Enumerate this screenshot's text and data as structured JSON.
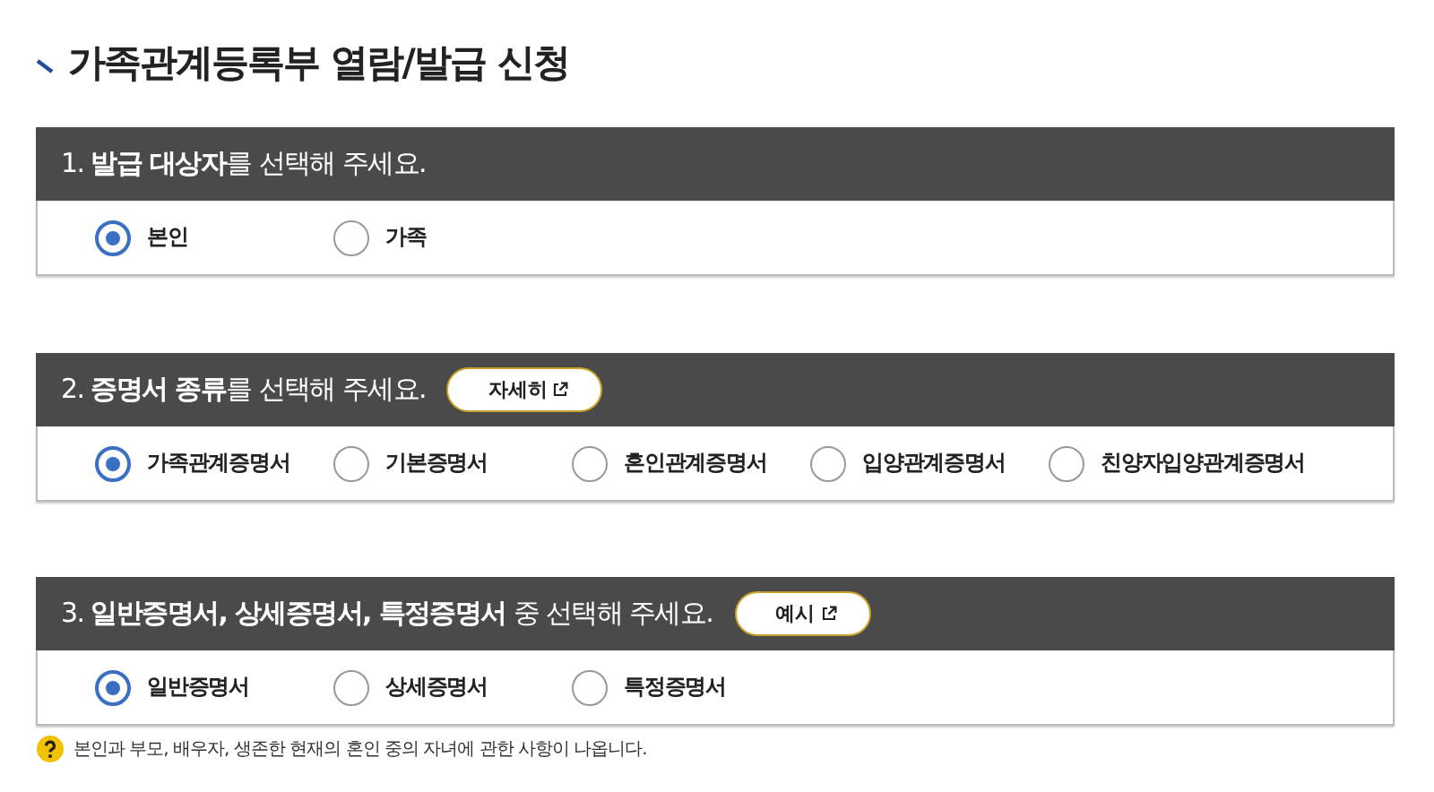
{
  "title": "가족관계등록부 열람/발급 신청",
  "sections": [
    {
      "heading": "1. **발급 대상자**를 선택해 주세요.",
      "options": [
        {
          "label": "본인",
          "selected": true
        },
        {
          "label": "가족",
          "selected": false
        }
      ]
    },
    {
      "heading": "2. **증명서 종류**를 선택해 주세요.",
      "button": "자세히",
      "options": [
        {
          "label": "가족관계증명서",
          "selected": true
        },
        {
          "label": "기본증명서",
          "selected": false
        },
        {
          "label": "혼인관계증명서",
          "selected": false
        },
        {
          "label": "입양관계증명서",
          "selected": false
        },
        {
          "label": "친양자입양관계증명서",
          "selected": false
        }
      ]
    },
    {
      "heading": "3. **일반증명서, 상세증명서, 특정증명서** 중 선택해 주세요.",
      "button": "예시",
      "options": [
        {
          "label": "일반증명서",
          "selected": true
        },
        {
          "label": "상세증명서",
          "selected": false
        },
        {
          "label": "특정증명서",
          "selected": false
        }
      ]
    }
  ],
  "note": "본인과 부모, 배우자, 생존한 현재의 혼인 중의 자녀에 관한 사항이 나옵니다."
}
